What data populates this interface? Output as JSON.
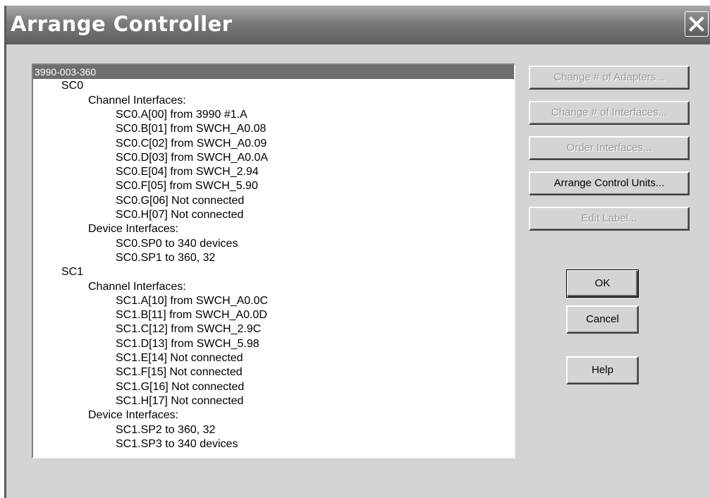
{
  "window": {
    "title": "Arrange Controller",
    "close_icon": "close-x-icon"
  },
  "tree": [
    {
      "label": "3990-003-360",
      "level": 0,
      "selected": true
    },
    {
      "label": "SC0",
      "level": 1
    },
    {
      "label": "Channel Interfaces:",
      "level": 2
    },
    {
      "label": "SC0.A[00] from 3990 #1.A",
      "level": 3
    },
    {
      "label": "SC0.B[01] from SWCH_A0.08",
      "level": 3
    },
    {
      "label": "SC0.C[02] from SWCH_A0.09",
      "level": 3
    },
    {
      "label": "SC0.D[03] from SWCH_A0.0A",
      "level": 3
    },
    {
      "label": "SC0.E[04] from SWCH_2.94",
      "level": 3
    },
    {
      "label": "SC0.F[05] from SWCH_5.90",
      "level": 3
    },
    {
      "label": "SC0.G[06] Not connected",
      "level": 3
    },
    {
      "label": "SC0.H[07] Not connected",
      "level": 3
    },
    {
      "label": "Device Interfaces:",
      "level": 2
    },
    {
      "label": "SC0.SP0 to 340 devices",
      "level": 3
    },
    {
      "label": "SC0.SP1 to 360, 32",
      "level": 3
    },
    {
      "label": "SC1",
      "level": 1
    },
    {
      "label": "Channel Interfaces:",
      "level": 2
    },
    {
      "label": "SC1.A[10] from SWCH_A0.0C",
      "level": 3
    },
    {
      "label": "SC1.B[11] from SWCH_A0.0D",
      "level": 3
    },
    {
      "label": "SC1.C[12] from SWCH_2.9C",
      "level": 3
    },
    {
      "label": "SC1.D[13] from SWCH_5.98",
      "level": 3
    },
    {
      "label": "SC1.E[14] Not connected",
      "level": 3
    },
    {
      "label": "SC1.F[15] Not connected",
      "level": 3
    },
    {
      "label": "SC1.G[16] Not connected",
      "level": 3
    },
    {
      "label": "SC1.H[17] Not connected",
      "level": 3
    },
    {
      "label": "Device Interfaces:",
      "level": 2
    },
    {
      "label": "SC1.SP2 to 360, 32",
      "level": 3
    },
    {
      "label": "SC1.SP3 to 340 devices",
      "level": 3
    }
  ],
  "buttons": {
    "change_adapters": {
      "label": "Change # of Adapters...",
      "enabled": false
    },
    "change_interfaces": {
      "label": "Change # of Interfaces...",
      "enabled": false
    },
    "order_interfaces": {
      "label": "Order Interfaces...",
      "enabled": false
    },
    "arrange_control_units": {
      "label": "Arrange Control Units...",
      "enabled": true
    },
    "edit_label": {
      "label": "Edit Label...",
      "enabled": false
    },
    "ok": {
      "label": "OK",
      "enabled": true
    },
    "cancel": {
      "label": "Cancel",
      "enabled": true
    },
    "help": {
      "label": "Help",
      "enabled": true
    }
  }
}
